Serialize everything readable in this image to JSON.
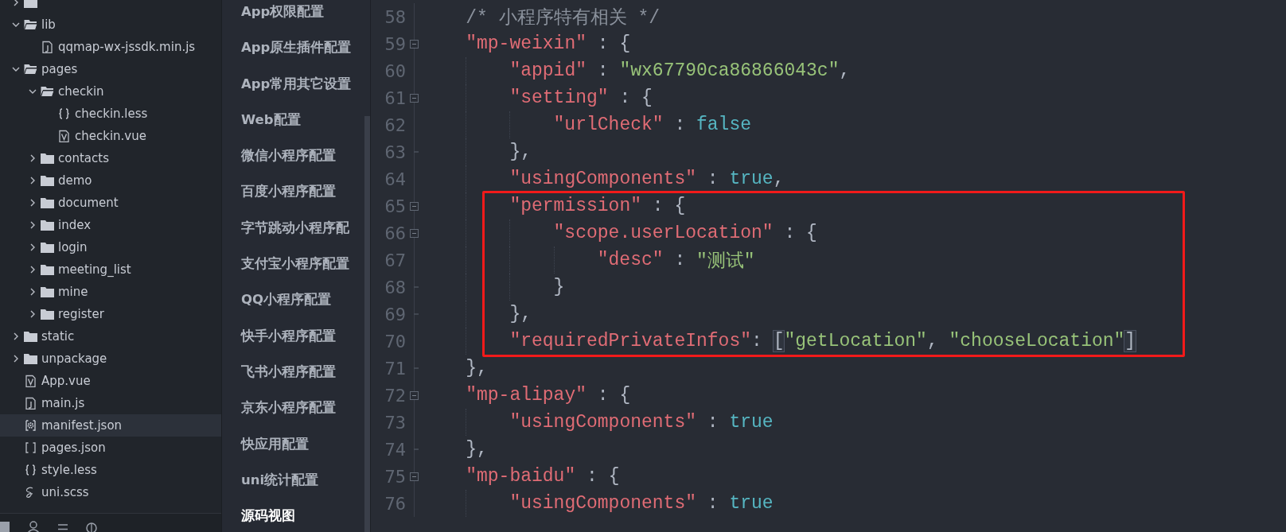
{
  "file_tree": [
    {
      "kind": "folder",
      "expanded": false,
      "selected": false
    },
    {
      "name": "lib",
      "kind": "folder",
      "expanded": true,
      "selected": false,
      "children": [
        {
          "name": "qqmap-wx-jssdk.min.js",
          "kind": "js",
          "selected": false
        }
      ]
    },
    {
      "name": "pages",
      "kind": "folder",
      "expanded": true,
      "selected": false,
      "children": [
        {
          "name": "checkin",
          "kind": "folder",
          "expanded": true,
          "selected": false,
          "children": [
            {
              "name": "checkin.less",
              "kind": "braces",
              "selected": false
            },
            {
              "name": "checkin.vue",
              "kind": "vue",
              "selected": false
            }
          ]
        },
        {
          "name": "contacts",
          "kind": "folder",
          "expanded": false,
          "selected": false
        },
        {
          "name": "demo",
          "kind": "folder",
          "expanded": false,
          "selected": false
        },
        {
          "name": "document",
          "kind": "folder",
          "expanded": false,
          "selected": false
        },
        {
          "name": "index",
          "kind": "folder",
          "expanded": false,
          "selected": false
        },
        {
          "name": "login",
          "kind": "folder",
          "expanded": false,
          "selected": false
        },
        {
          "name": "meeting_list",
          "kind": "folder",
          "expanded": false,
          "selected": false
        },
        {
          "name": "mine",
          "kind": "folder",
          "expanded": false,
          "selected": false
        },
        {
          "name": "register",
          "kind": "folder",
          "expanded": false,
          "selected": false
        }
      ]
    },
    {
      "name": "static",
      "kind": "folder",
      "expanded": false,
      "selected": false
    },
    {
      "name": "unpackage",
      "kind": "folder",
      "expanded": false,
      "selected": false
    },
    {
      "name": "App.vue",
      "kind": "vue",
      "selected": false
    },
    {
      "name": "main.js",
      "kind": "js",
      "selected": false
    },
    {
      "name": "manifest.json",
      "kind": "settings",
      "selected": true
    },
    {
      "name": "pages.json",
      "kind": "brackets",
      "selected": false
    },
    {
      "name": "style.less",
      "kind": "braces",
      "selected": false
    },
    {
      "name": "uni.scss",
      "kind": "sass",
      "selected": false
    }
  ],
  "config_nav": [
    {
      "label": "App权限配置",
      "selected": false
    },
    {
      "label": "App原生插件配置",
      "selected": false
    },
    {
      "label": "App常用其它设置",
      "selected": false
    },
    {
      "label": "Web配置",
      "selected": false
    },
    {
      "label": "微信小程序配置",
      "selected": false
    },
    {
      "label": "百度小程序配置",
      "selected": false
    },
    {
      "label": "字节跳动小程序配",
      "selected": false
    },
    {
      "label": "支付宝小程序配置",
      "selected": false
    },
    {
      "label": "QQ小程序配置",
      "selected": false
    },
    {
      "label": "快手小程序配置",
      "selected": false
    },
    {
      "label": "飞书小程序配置",
      "selected": false
    },
    {
      "label": "京东小程序配置",
      "selected": false
    },
    {
      "label": "快应用配置",
      "selected": false
    },
    {
      "label": "uni统计配置",
      "selected": false
    },
    {
      "label": "源码视图",
      "selected": true
    }
  ],
  "editor": {
    "lines": [
      {
        "number": "58",
        "kind": "plain",
        "boxed": false,
        "tokens": [
          {
            "kind": "comment",
            "text": "/* 小程序特有相关 */"
          }
        ]
      },
      {
        "number": "59",
        "kind": "opener",
        "boxed": false,
        "tokens": [
          {
            "kind": "key",
            "text": "\"mp-weixin\""
          },
          {
            "kind": "punct",
            "text": " : {"
          }
        ],
        "children": [
          {
            "number": "60",
            "kind": "plain",
            "boxed": false,
            "tokens": [
              {
                "kind": "key",
                "text": "\"appid\""
              },
              {
                "kind": "punct",
                "text": " : "
              },
              {
                "kind": "string",
                "text": "\"wx67790ca86866043c\""
              },
              {
                "kind": "punct",
                "text": ","
              }
            ]
          },
          {
            "number": "61",
            "kind": "opener",
            "boxed": false,
            "tokens": [
              {
                "kind": "key",
                "text": "\"setting\""
              },
              {
                "kind": "punct",
                "text": " : {"
              }
            ],
            "children": [
              {
                "number": "62",
                "kind": "plain",
                "boxed": false,
                "tokens": [
                  {
                    "kind": "key",
                    "text": "\"urlCheck\""
                  },
                  {
                    "kind": "punct",
                    "text": " : "
                  },
                  {
                    "kind": "literal",
                    "text": "false"
                  }
                ]
              }
            ]
          },
          {
            "number": "63",
            "kind": "closer",
            "boxed": false,
            "tokens": [
              {
                "kind": "punct",
                "text": "},"
              }
            ]
          },
          {
            "number": "64",
            "kind": "plain",
            "boxed": false,
            "tokens": [
              {
                "kind": "key",
                "text": "\"usingComponents\""
              },
              {
                "kind": "punct",
                "text": " : "
              },
              {
                "kind": "literal",
                "text": "true"
              },
              {
                "kind": "punct",
                "text": ","
              }
            ]
          },
          {
            "number": "65",
            "kind": "opener",
            "boxed": true,
            "tokens": [
              {
                "kind": "key",
                "text": "\"permission\""
              },
              {
                "kind": "punct",
                "text": " : {"
              }
            ],
            "children": [
              {
                "number": "66",
                "kind": "opener",
                "boxed": true,
                "tokens": [
                  {
                    "kind": "key",
                    "text": "\"scope.userLocation\""
                  },
                  {
                    "kind": "punct",
                    "text": " : {"
                  }
                ],
                "children": [
                  {
                    "number": "67",
                    "kind": "plain",
                    "boxed": true,
                    "tokens": [
                      {
                        "kind": "key",
                        "text": "\"desc\""
                      },
                      {
                        "kind": "punct",
                        "text": " : "
                      },
                      {
                        "kind": "string",
                        "text": "\"测试\""
                      }
                    ]
                  }
                ]
              },
              {
                "number": "68",
                "kind": "closer",
                "boxed": true,
                "tokens": [
                  {
                    "kind": "punct",
                    "text": "}"
                  }
                ]
              }
            ]
          },
          {
            "number": "69",
            "kind": "closer",
            "boxed": true,
            "tokens": [
              {
                "kind": "punct",
                "text": "},"
              }
            ]
          },
          {
            "number": "70",
            "kind": "plain",
            "boxed": true,
            "tokens": [
              {
                "kind": "key",
                "text": "\"requiredPrivateInfos\""
              },
              {
                "kind": "punct",
                "text": ": "
              },
              {
                "kind": "match",
                "text": "["
              },
              {
                "kind": "string",
                "text": "\"getLocation\""
              },
              {
                "kind": "punct",
                "text": ", "
              },
              {
                "kind": "string",
                "text": "\"chooseLocation\""
              },
              {
                "kind": "match",
                "text": "]"
              }
            ]
          }
        ]
      },
      {
        "number": "71",
        "kind": "closer",
        "boxed": false,
        "tokens": [
          {
            "kind": "punct",
            "text": "},"
          }
        ]
      },
      {
        "number": "72",
        "kind": "opener",
        "boxed": false,
        "tokens": [
          {
            "kind": "key",
            "text": "\"mp-alipay\""
          },
          {
            "kind": "punct",
            "text": " : {"
          }
        ],
        "children": [
          {
            "number": "73",
            "kind": "plain",
            "boxed": false,
            "tokens": [
              {
                "kind": "key",
                "text": "\"usingComponents\""
              },
              {
                "kind": "punct",
                "text": " : "
              },
              {
                "kind": "literal",
                "text": "true"
              }
            ]
          }
        ]
      },
      {
        "number": "74",
        "kind": "closer",
        "boxed": false,
        "tokens": [
          {
            "kind": "punct",
            "text": "},"
          }
        ]
      },
      {
        "number": "75",
        "kind": "opener",
        "boxed": false,
        "tokens": [
          {
            "kind": "key",
            "text": "\"mp-baidu\""
          },
          {
            "kind": "punct",
            "text": " : {"
          }
        ],
        "children": [
          {
            "number": "76",
            "kind": "plain",
            "boxed": false,
            "tokens": [
              {
                "kind": "key",
                "text": "\"usingComponents\""
              },
              {
                "kind": "punct",
                "text": " : "
              },
              {
                "kind": "literal",
                "text": "true"
              }
            ]
          }
        ]
      }
    ]
  }
}
